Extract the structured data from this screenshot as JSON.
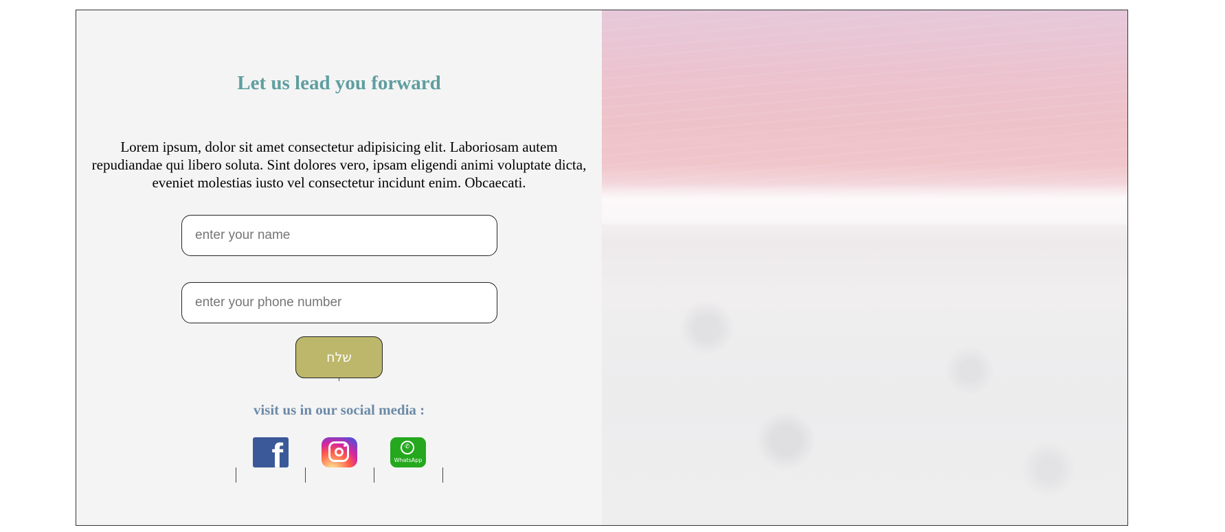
{
  "form_section": {
    "title": "Let us lead you forward",
    "description": "Lorem ipsum, dolor sit amet consectetur adipisicing elit. Laboriosam autem repudiandae qui libero soluta. Sint dolores vero, ipsam eligendi animi voluptate dicta, eveniet molestias iusto vel consectetur incidunt enim. Obcaecati.",
    "name_input": {
      "value": "",
      "placeholder": "enter your name"
    },
    "phone_input": {
      "value": "",
      "placeholder": "enter your phone number"
    },
    "send_button_label": "שלח"
  },
  "social": {
    "heading": "visit us in our social media :",
    "links": [
      {
        "icon": "facebook-icon",
        "glyph": "f"
      },
      {
        "icon": "instagram-icon"
      },
      {
        "icon": "whatsapp-icon",
        "text": "WhatsApp"
      }
    ]
  },
  "colors": {
    "title": "#5f9ea0",
    "social_heading": "#6c8aa8",
    "send_button": "#bdb76b",
    "panel_background": "#f4f4f4",
    "facebook": "#3b5998",
    "whatsapp": "#25a81e"
  },
  "hero_image": {
    "subject": "pink-lake-and-white-sand"
  }
}
